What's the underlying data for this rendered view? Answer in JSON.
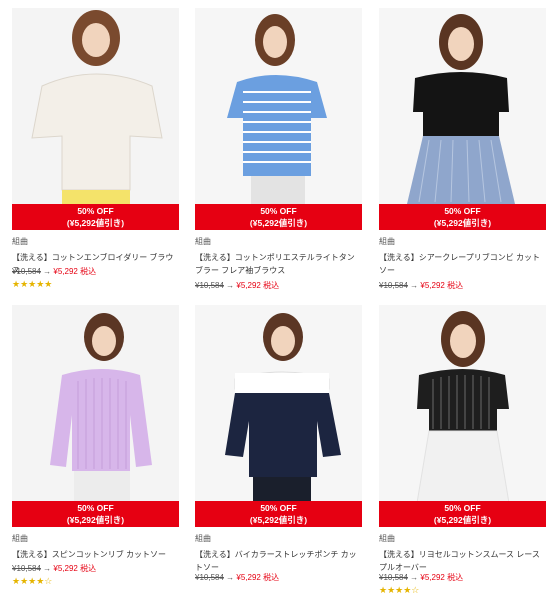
{
  "products": [
    {
      "discount": "50% OFF",
      "discount_amount": "(¥5,292値引き)",
      "brand": "組曲",
      "name": "【洗える】コットンエンブロイダリー ブラウス",
      "original_price": "¥10,584",
      "arrow": "→",
      "sale_price": "¥5,292",
      "tax_label": "税込",
      "stars": "★★★★★",
      "rating": 5,
      "top_color": "#f3efe8",
      "bottom_color": "#f4e36a",
      "bg_color": "#f4f4f4"
    },
    {
      "discount": "50% OFF",
      "discount_amount": "(¥5,292値引き)",
      "brand": "組曲",
      "name": "【洗える】コットンポリエステルライトタンブラー フレア袖ブラウス",
      "original_price": "¥10,584",
      "arrow": "→",
      "sale_price": "¥5,292",
      "tax_label": "税込",
      "stars": "",
      "rating": 0,
      "top_color": "#6b9fe0",
      "bottom_color": "#e3e3e3",
      "bg_color": "#f6f6f6"
    },
    {
      "discount": "50% OFF",
      "discount_amount": "(¥5,292値引き)",
      "brand": "組曲",
      "name": "【洗える】シアークレープリブコンビ カットソー",
      "original_price": "¥10,584",
      "arrow": "→",
      "sale_price": "¥5,292",
      "tax_label": "税込",
      "stars": "",
      "rating": 0,
      "top_color": "#141414",
      "bottom_color": "#8fa6cc",
      "bg_color": "#f6f6f6"
    },
    {
      "discount": "50% OFF",
      "discount_amount": "(¥5,292値引き)",
      "brand": "組曲",
      "name": "【洗える】スピンコットンリブ カットソー",
      "original_price": "¥10,584",
      "arrow": "→",
      "sale_price": "¥5,292",
      "tax_label": "税込",
      "stars": "★★★★☆",
      "rating": 4,
      "top_color": "#d7b6ea",
      "bottom_color": "#ececec",
      "bg_color": "#f4f4f4"
    },
    {
      "discount": "50% OFF",
      "discount_amount": "(¥5,292値引き)",
      "brand": "組曲",
      "name": "【洗える】バイカラーストレッチポンチ カットソー",
      "original_price": "¥10,584",
      "arrow": "→",
      "sale_price": "¥5,292",
      "tax_label": "税込",
      "stars": "",
      "rating": 0,
      "top_color": "#1c2540",
      "bottom_color": "#1a1f2c",
      "bg_color": "#f6f6f6"
    },
    {
      "discount": "50% OFF",
      "discount_amount": "(¥5,292値引き)",
      "brand": "組曲",
      "name": "【洗える】リヨセルコットンスムース レースプルオーバー",
      "original_price": "¥10,584",
      "arrow": "→",
      "sale_price": "¥5,292",
      "tax_label": "税込",
      "stars": "★★★★☆",
      "rating": 4.5,
      "top_color": "#1e1e1e",
      "bottom_color": "#f1f1f1",
      "bg_color": "#f6f6f6"
    }
  ],
  "colors": {
    "sale_red": "#e60012",
    "star_gold": "#e5b400"
  }
}
